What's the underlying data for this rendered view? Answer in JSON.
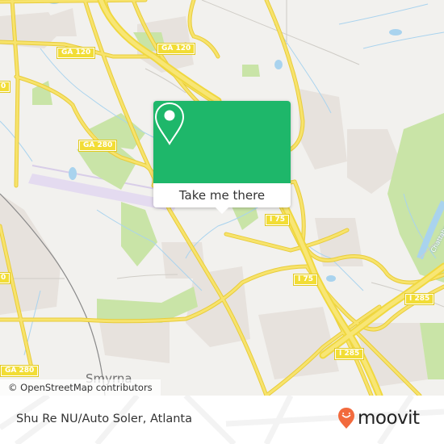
{
  "map": {
    "shields": [
      {
        "label": "GA 120",
        "id": "ga-120-west"
      },
      {
        "label": "GA 120",
        "id": "ga-120-east"
      },
      {
        "label": "GA 280",
        "id": "ga-280-north"
      },
      {
        "label": "GA 280",
        "id": "ga-280-south"
      },
      {
        "label": "I 75",
        "id": "i-75-north"
      },
      {
        "label": "I 75",
        "id": "i-75-south"
      },
      {
        "label": "I 285",
        "id": "i-285-east"
      },
      {
        "label": "I 285",
        "id": "i-285-south"
      },
      {
        "label": "0",
        "id": "partial-west-1"
      },
      {
        "label": "0",
        "id": "partial-west-2"
      }
    ],
    "place_labels": {
      "smyrna": "Smyrna",
      "river": "Chattahoochee"
    },
    "colors": {
      "background": "#f2f1ee",
      "road": "#f6e06a",
      "road_casing": "#e8cc3a",
      "park": "#c8e3a6",
      "water": "#a9d3ee",
      "urban": "#e6e1dc",
      "airport": "#e6dcf1"
    }
  },
  "popup": {
    "icon": "map-pin-icon",
    "button_label": "Take me there",
    "color": "#1eb76a"
  },
  "attribution": {
    "text": "© OpenStreetMap contributors"
  },
  "footer": {
    "place_name": "Shu Re NU/Auto Soler, Atlanta",
    "logo_text": "moovit",
    "logo_color": "#f26a3d"
  }
}
